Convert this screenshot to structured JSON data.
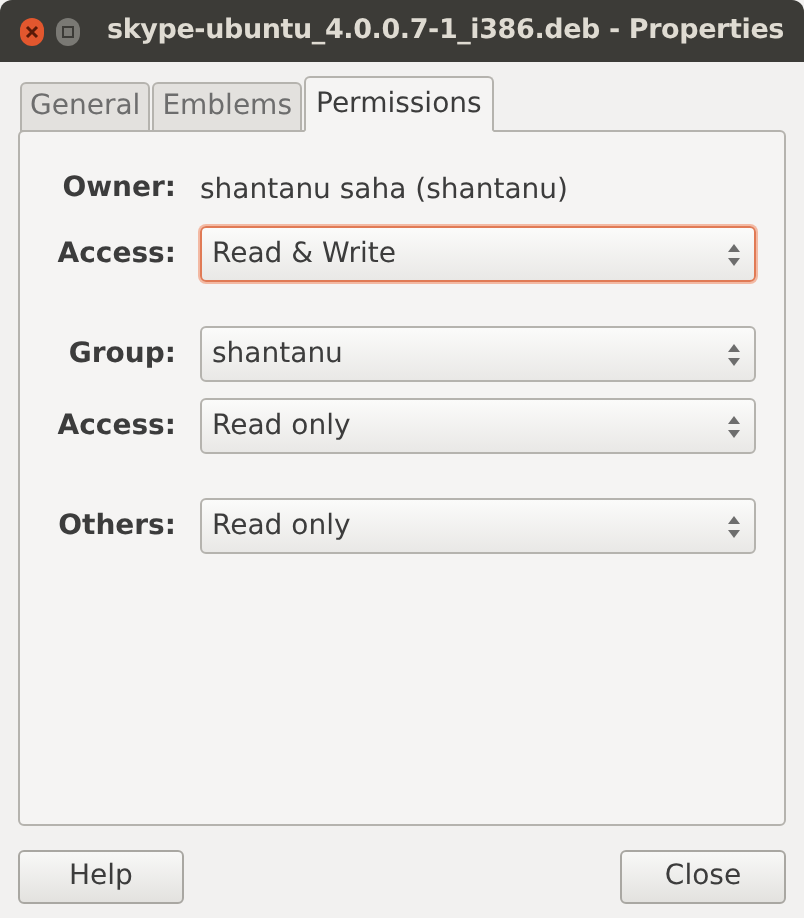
{
  "window": {
    "title": "skype-ubuntu_4.0.0.7-1_i386.deb - Properties"
  },
  "tabs": [
    {
      "label": "General",
      "selected": false
    },
    {
      "label": "Emblems",
      "selected": false
    },
    {
      "label": "Permissions",
      "selected": true
    }
  ],
  "sections": [
    {
      "rows": [
        {
          "kind": "text",
          "label": "Owner:",
          "value": "shantanu saha (shantanu)"
        },
        {
          "kind": "select",
          "label": "Access:",
          "value": "Read & Write",
          "focused": true
        }
      ]
    },
    {
      "rows": [
        {
          "kind": "select",
          "label": "Group:",
          "value": "shantanu",
          "focused": false
        },
        {
          "kind": "select",
          "label": "Access:",
          "value": "Read only",
          "focused": false
        }
      ]
    },
    {
      "rows": [
        {
          "kind": "select",
          "label": "Others:",
          "value": "Read only",
          "focused": false
        }
      ]
    }
  ],
  "buttons": [
    {
      "label": "Help"
    },
    {
      "label": "Close"
    }
  ]
}
